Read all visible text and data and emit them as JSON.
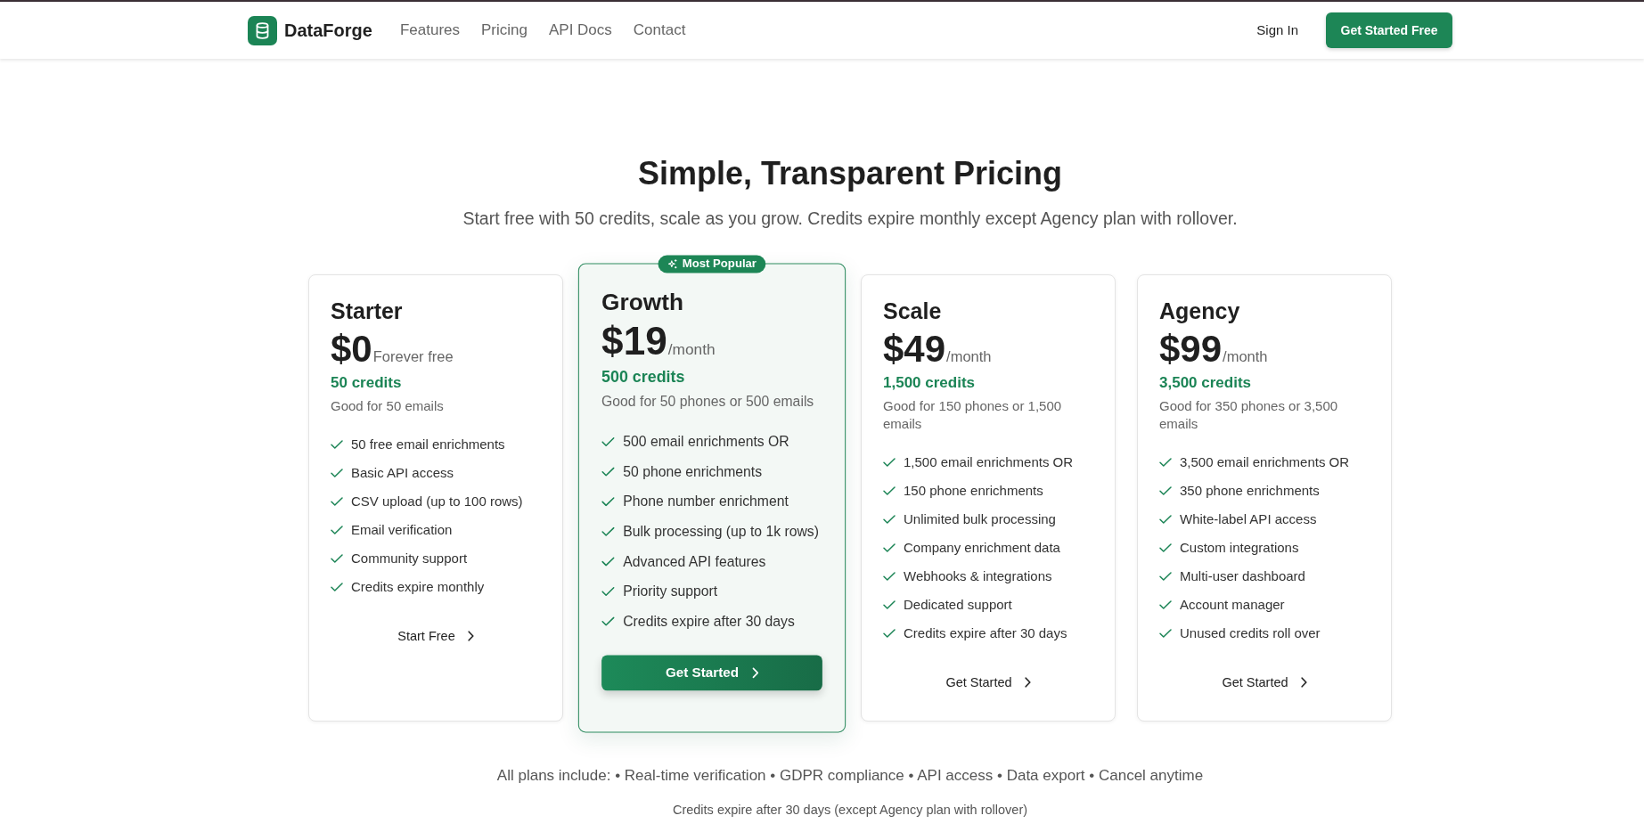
{
  "navbar": {
    "brand": "DataForge",
    "links": [
      "Features",
      "Pricing",
      "API Docs",
      "Contact"
    ],
    "sign_in": "Sign In",
    "cta": "Get Started Free"
  },
  "header": {
    "title": "Simple, Transparent Pricing",
    "subtitle": "Start free with 50 credits, scale as you grow. Credits expire monthly except Agency plan with rollover."
  },
  "plans": [
    {
      "name": "Starter",
      "price": "$0",
      "period": "Forever free",
      "credits": "50 credits",
      "note": "Good for 50 emails",
      "features": [
        "50 free email enrichments",
        "Basic API access",
        "CSV upload (up to 100 rows)",
        "Email verification",
        "Community support",
        "Credits expire monthly"
      ],
      "button": "Start Free",
      "featured": false
    },
    {
      "name": "Growth",
      "badge": "Most Popular",
      "price": "$19",
      "period": "/month",
      "credits": "500 credits",
      "note": "Good for 50 phones or 500 emails",
      "features": [
        "500 email enrichments OR",
        "50 phone enrichments",
        "Phone number enrichment",
        "Bulk processing (up to 1k rows)",
        "Advanced API features",
        "Priority support",
        "Credits expire after 30 days"
      ],
      "button": "Get Started",
      "featured": true
    },
    {
      "name": "Scale",
      "price": "$49",
      "period": "/month",
      "credits": "1,500 credits",
      "note": "Good for 150 phones or 1,500 emails",
      "features": [
        "1,500 email enrichments OR",
        "150 phone enrichments",
        "Unlimited bulk processing",
        "Company enrichment data",
        "Webhooks & integrations",
        "Dedicated support",
        "Credits expire after 30 days"
      ],
      "button": "Get Started",
      "featured": false
    },
    {
      "name": "Agency",
      "price": "$99",
      "period": "/month",
      "credits": "3,500 credits",
      "note": "Good for 350 phones or 3,500 emails",
      "features": [
        "3,500 email enrichments OR",
        "350 phone enrichments",
        "White-label API access",
        "Custom integrations",
        "Multi-user dashboard",
        "Account manager",
        "Unused credits roll over"
      ],
      "button": "Get Started",
      "featured": false
    }
  ],
  "footer": {
    "includes": "All plans include: • Real-time verification • GDPR compliance • API access • Data export • Cancel anytime",
    "note": "Credits expire after 30 days (except Agency plan with rollover)"
  }
}
